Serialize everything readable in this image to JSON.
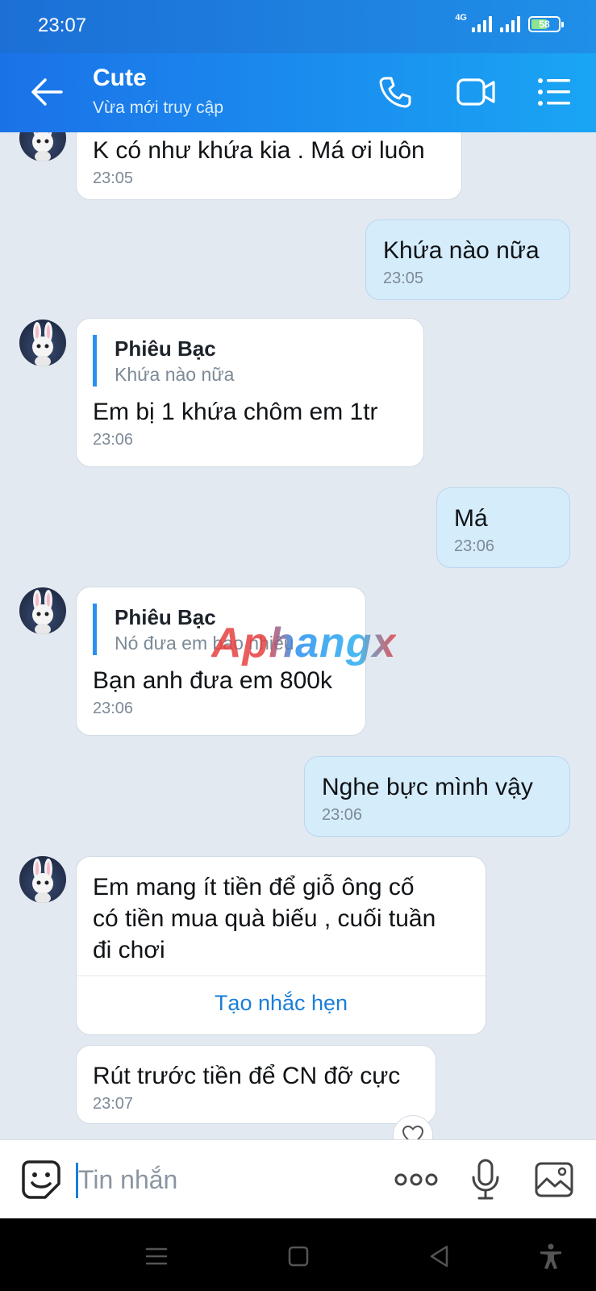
{
  "status_bar": {
    "time": "23:07",
    "network": "4G",
    "battery": "58",
    "battery_level": 0.58
  },
  "header": {
    "contact_name": "Cute",
    "contact_status": "Vừa mới truy cập"
  },
  "messages": [
    {
      "direction": "in",
      "text": "K có như khứa kia . Má ơi luôn",
      "time": "23:05"
    },
    {
      "direction": "out",
      "text": "Khứa nào nữa",
      "time": "23:05"
    },
    {
      "direction": "in",
      "quote_name": "Phiêu Bạc",
      "quote_text": "Khứa nào nữa",
      "text": "Em bị 1 khứa chôm em 1tr",
      "time": "23:06"
    },
    {
      "direction": "out",
      "text": "Má",
      "time": "23:06"
    },
    {
      "direction": "in",
      "quote_name": "Phiêu Bạc",
      "quote_text": "Nó đưa em bao nhiêu",
      "text": "Bạn anh đưa em 800k",
      "time": "23:06"
    },
    {
      "direction": "out",
      "text": "Nghe bực mình vậy",
      "time": "23:06"
    },
    {
      "direction": "in",
      "text_lines": [
        "Em mang ít tiền để giỗ ông cố",
        "có tiền mua quà biếu , cuối tuần",
        "đi chơi"
      ],
      "action": "Tạo nhắc hẹn"
    },
    {
      "direction": "in",
      "text": "Rút trước tiền để CN đỡ cực",
      "time": "23:07"
    }
  ],
  "watermark": "Aphangx",
  "input": {
    "placeholder": "Tin nhắn"
  },
  "icons": {
    "back": "arrow-left-icon",
    "call": "phone-icon",
    "video": "video-camera-icon",
    "menu": "list-menu-icon",
    "emoji": "sticker-icon",
    "more": "more-dots-icon",
    "mic": "microphone-icon",
    "image": "image-icon",
    "heart": "heart-icon",
    "nav_menu": "menu-icon",
    "nav_home": "home-icon",
    "nav_back": "back-triangle-icon",
    "accessibility": "accessibility-icon"
  },
  "colors": {
    "header": "#1b72e8",
    "background": "#e2e9f1",
    "outgoing_bubble": "#d5ecfb",
    "incoming_bubble": "#ffffff",
    "accent": "#1a7ed8"
  }
}
